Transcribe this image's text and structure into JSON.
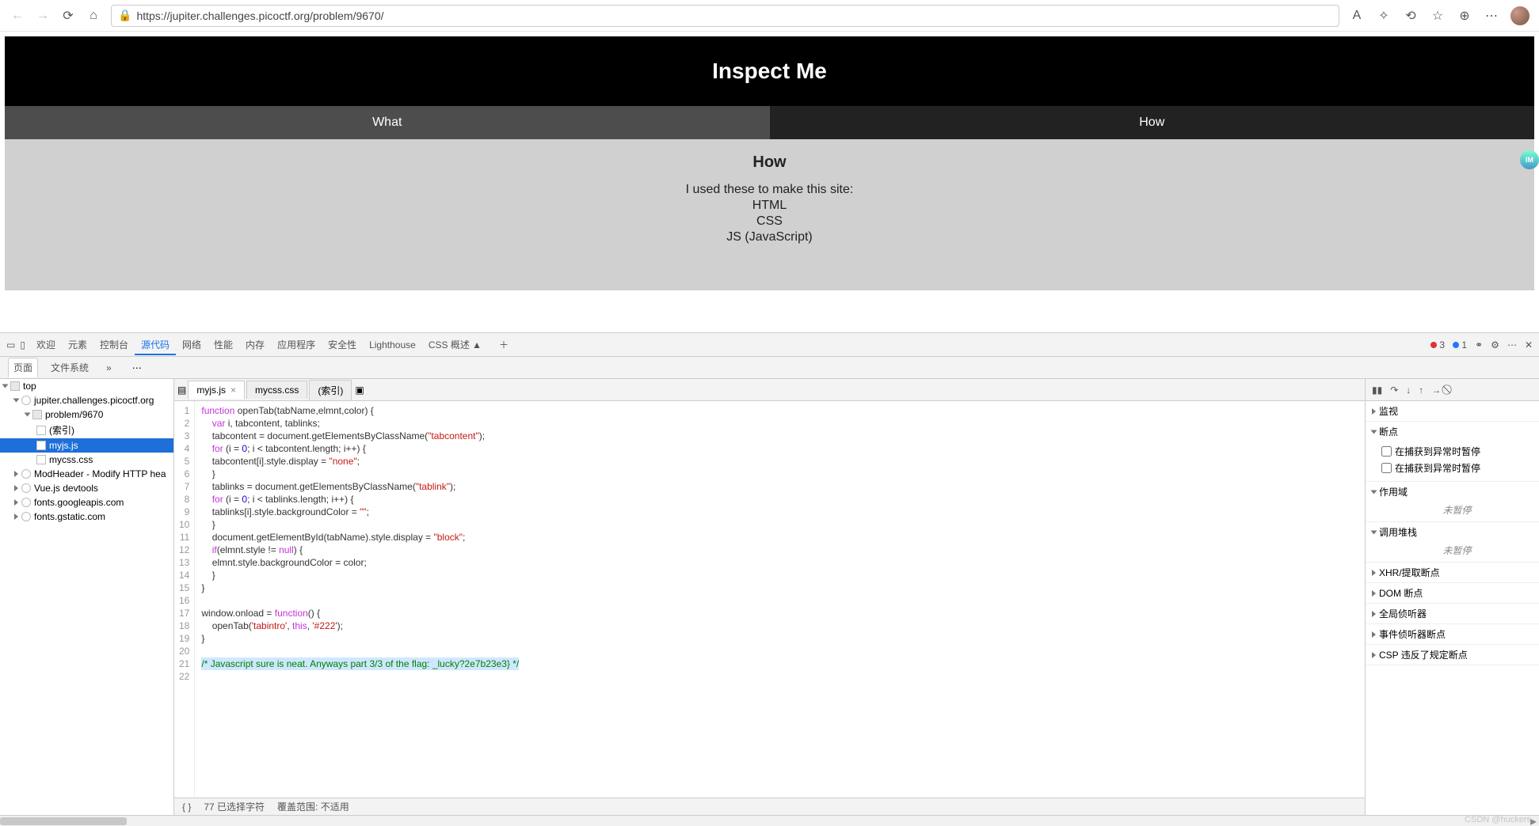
{
  "browser": {
    "url": "https://jupiter.challenges.picoctf.org/problem/9670/",
    "zoom_label": "A",
    "badge_text": "IM"
  },
  "page": {
    "title": "Inspect Me",
    "tabs": {
      "what": "What",
      "how": "How"
    },
    "content": {
      "heading": "How",
      "intro": "I used these to make this site:",
      "items": [
        "HTML",
        "CSS",
        "JS (JavaScript)"
      ]
    }
  },
  "devtools": {
    "toptabs": [
      "欢迎",
      "元素",
      "控制台",
      "源代码",
      "网络",
      "性能",
      "内存",
      "应用程序",
      "安全性",
      "Lighthouse",
      "CSS 概述 ▲"
    ],
    "active_top": "源代码",
    "errors": 3,
    "info": 1,
    "subtabs": {
      "page": "页面",
      "filesystem": "文件系统"
    },
    "filetree": {
      "top": "top",
      "domain": "jupiter.challenges.picoctf.org",
      "folder": "problem/9670",
      "files_in_folder": [
        "(索引)",
        "myjs.js",
        "mycss.css"
      ],
      "selected": "myjs.js",
      "externals": [
        "ModHeader - Modify HTTP hea",
        "Vue.js devtools",
        "fonts.googleapis.com",
        "fonts.gstatic.com"
      ]
    },
    "editor": {
      "tabs": [
        "myjs.js",
        "mycss.css",
        "(索引)"
      ],
      "active": "myjs.js",
      "code_lines": [
        {
          "n": 1,
          "html": "<span class='kw'>function</span> openTab(tabName,elmnt,color) {"
        },
        {
          "n": 2,
          "html": "    <span class='kw'>var</span> i, tabcontent, tablinks;"
        },
        {
          "n": 3,
          "html": "    tabcontent = document.getElementsByClassName(<span class='str'>\"tabcontent\"</span>);"
        },
        {
          "n": 4,
          "html": "    <span class='kw'>for</span> (i = <span class='num'>0</span>; i &lt; tabcontent.length; i++) {"
        },
        {
          "n": 5,
          "html": "    tabcontent[i].style.display = <span class='str'>\"none\"</span>;"
        },
        {
          "n": 6,
          "html": "    }"
        },
        {
          "n": 7,
          "html": "    tablinks = document.getElementsByClassName(<span class='str'>\"tablink\"</span>);"
        },
        {
          "n": 8,
          "html": "    <span class='kw'>for</span> (i = <span class='num'>0</span>; i &lt; tablinks.length; i++) {"
        },
        {
          "n": 9,
          "html": "    tablinks[i].style.backgroundColor = <span class='str'>\"\"</span>;"
        },
        {
          "n": 10,
          "html": "    }"
        },
        {
          "n": 11,
          "html": "    document.getElementById(tabName).style.display = <span class='str'>\"block\"</span>;"
        },
        {
          "n": 12,
          "html": "    <span class='kw'>if</span>(elmnt.style != <span class='kw'>null</span>) {"
        },
        {
          "n": 13,
          "html": "    elmnt.style.backgroundColor = color;"
        },
        {
          "n": 14,
          "html": "    }"
        },
        {
          "n": 15,
          "html": "}"
        },
        {
          "n": 16,
          "html": ""
        },
        {
          "n": 17,
          "html": "window.onload = <span class='kw'>function</span>() {"
        },
        {
          "n": 18,
          "html": "    openTab(<span class='str'>'tabintro'</span>, <span class='kw'>this</span>, <span class='str'>'#222'</span>);"
        },
        {
          "n": 19,
          "html": "}"
        },
        {
          "n": 20,
          "html": ""
        },
        {
          "n": 21,
          "html": "<span class='hl'><span class='cm'>/* Javascript sure is neat. Anyways part 3/3 of the flag: _lucky?2e7b23e3} */</span></span>"
        },
        {
          "n": 22,
          "html": ""
        }
      ],
      "status": {
        "braces": "{ }",
        "sel": "77 已选择字符",
        "range": "覆盖范围: 不适用"
      }
    },
    "debugger": {
      "controls": [
        "pause",
        "step-over",
        "step-into",
        "step-out",
        "step",
        "deactivate"
      ],
      "sections": {
        "watch": "监视",
        "breakpoints": "断点",
        "bp_caught": "在捕获到异常时暂停",
        "bp_uncaught": "在捕获到异常时暂停",
        "scope": "作用域",
        "not_paused": "未暂停",
        "callstack": "调用堆栈",
        "xhr": "XHR/提取断点",
        "dom": "DOM 断点",
        "global": "全局侦听器",
        "event": "事件侦听器断点",
        "csp": "CSP 违反了规定断点"
      }
    }
  },
  "watermark": "CSDN @huckers"
}
